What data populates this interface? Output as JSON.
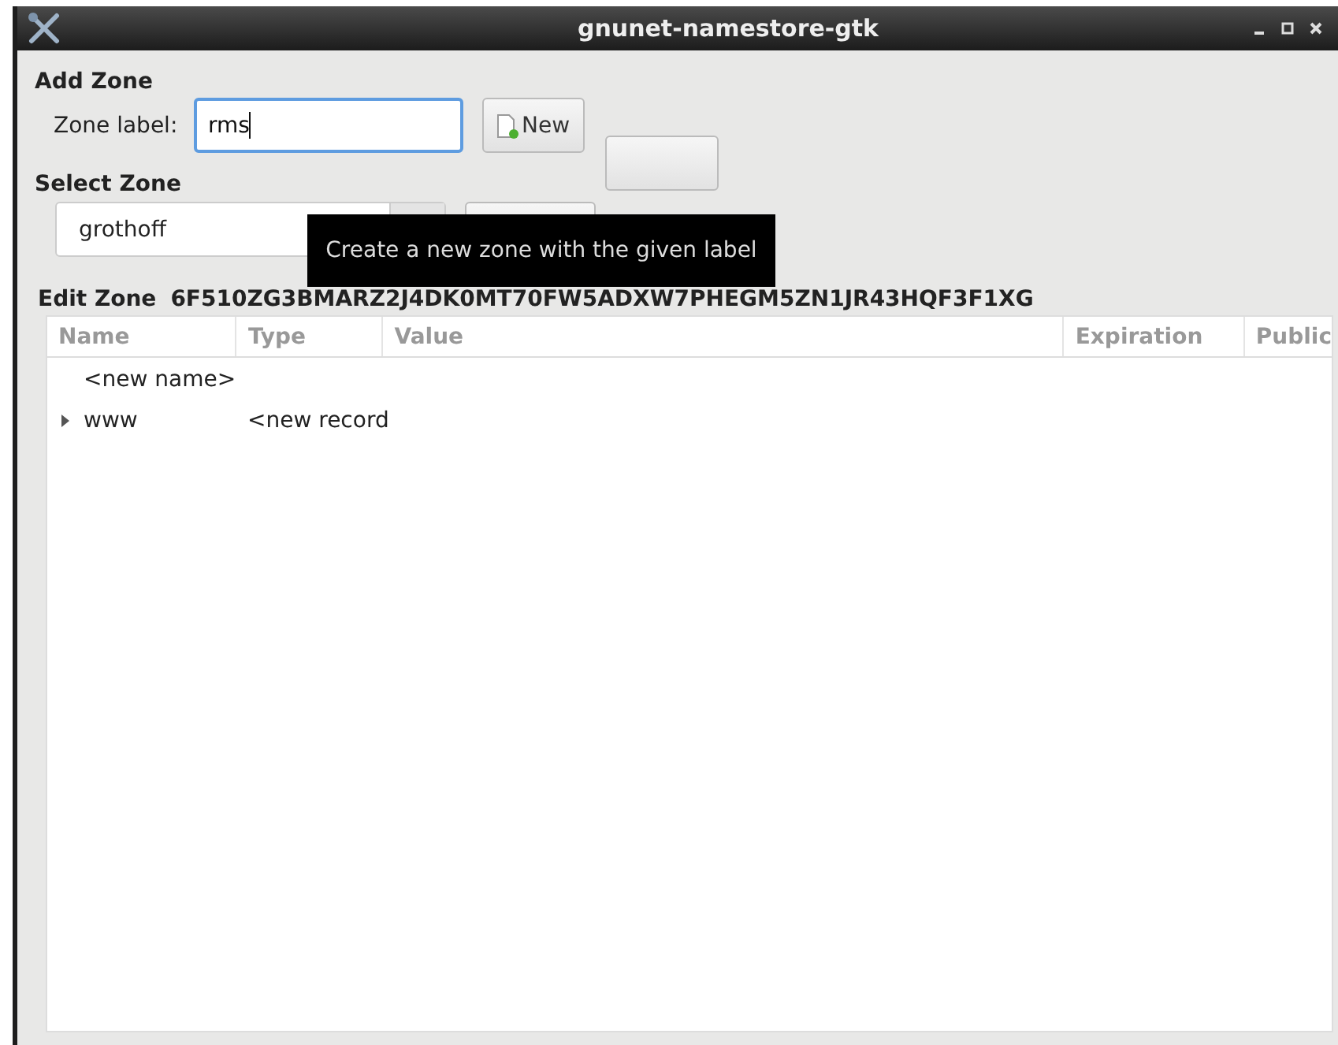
{
  "window": {
    "title": "gnunet-namestore-gtk"
  },
  "add_zone": {
    "heading": "Add Zone",
    "label": "Zone label:",
    "value": "rms",
    "new_button": "New"
  },
  "tooltip": {
    "text": "Create a new zone with the given label"
  },
  "select_zone": {
    "heading": "Select Zone",
    "value": "grothoff"
  },
  "edit_zone": {
    "heading": "Edit Zone",
    "key": "6F510ZG3BMARZ2J4DK0MT70FW5ADXW7PHEGM5ZN1JR43HQF3F1XG"
  },
  "table": {
    "columns": [
      "Name",
      "Type",
      "Value",
      "Expiration",
      "Public"
    ],
    "rows": [
      {
        "name": "<new name>"
      },
      {
        "name": "www",
        "type": "<new record",
        "expanded": false
      }
    ]
  }
}
